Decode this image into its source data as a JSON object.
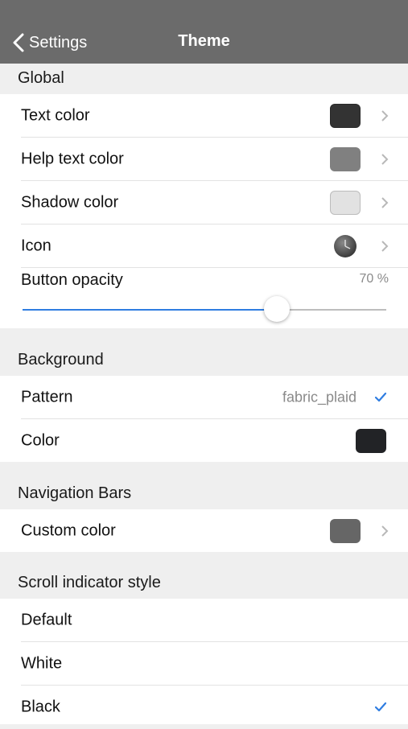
{
  "navbar": {
    "back_label": "Settings",
    "title": "Theme"
  },
  "sections": {
    "global": "Global",
    "background": "Background",
    "navigation_bars": "Navigation Bars",
    "scroll_indicator": "Scroll indicator style"
  },
  "global": {
    "text_color": {
      "label": "Text color",
      "color": "#333333"
    },
    "help_text_color": {
      "label": "Help text color",
      "color": "#808080"
    },
    "shadow_color": {
      "label": "Shadow color",
      "color": "#e2e2e2"
    },
    "icon": {
      "label": "Icon",
      "icon": "clock-icon"
    },
    "button_opacity": {
      "label": "Button opacity",
      "value_text": "70 %",
      "value": 0.7
    }
  },
  "background": {
    "pattern": {
      "label": "Pattern",
      "value": "fabric_plaid"
    },
    "color": {
      "label": "Color",
      "color": "#222326"
    }
  },
  "navigation_bars": {
    "custom_color": {
      "label": "Custom color",
      "color": "#666666"
    }
  },
  "scroll_indicator": {
    "options": [
      "Default",
      "White",
      "Black"
    ],
    "selected": "Black"
  },
  "colors": {
    "navbar_bg": "#6b6b6b",
    "accent": "#2f7de1"
  }
}
